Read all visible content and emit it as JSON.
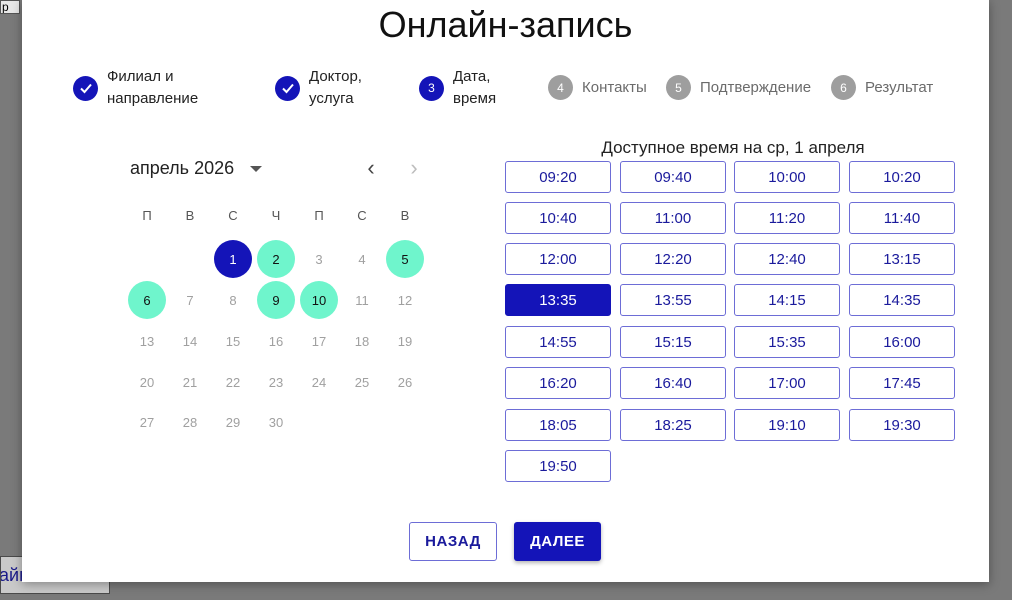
{
  "background": {
    "top_fragment": "р",
    "bottom_fragment": "айн"
  },
  "modal": {
    "title": "Онлайн-запись"
  },
  "steps": [
    {
      "status": "done",
      "icon": "check-icon",
      "label": "Филиал и\nнаправление"
    },
    {
      "status": "done",
      "icon": "check-icon",
      "label": "Доктор,\nуслуга"
    },
    {
      "status": "active",
      "number": "3",
      "label": "Дата,\nвремя"
    },
    {
      "status": "todo",
      "number": "4",
      "label": "Контакты"
    },
    {
      "status": "todo",
      "number": "5",
      "label": "Подтверждение"
    },
    {
      "status": "todo",
      "number": "6",
      "label": "Результат"
    }
  ],
  "calendar": {
    "month_label": "апрель 2026",
    "weekdays": [
      "П",
      "В",
      "С",
      "Ч",
      "П",
      "С",
      "В"
    ],
    "first_weekday_index": 2,
    "days_in_month": 30,
    "selected_day": 1,
    "available_days": [
      1,
      2,
      5,
      6,
      9,
      10
    ]
  },
  "slots": {
    "title": "Доступное время на ср, 1 апреля",
    "times": [
      "09:20",
      "09:40",
      "10:00",
      "10:20",
      "10:40",
      "11:00",
      "11:20",
      "11:40",
      "12:00",
      "12:20",
      "12:40",
      "13:15",
      "13:35",
      "13:55",
      "14:15",
      "14:35",
      "14:55",
      "15:15",
      "15:35",
      "16:00",
      "16:20",
      "16:40",
      "17:00",
      "17:45",
      "18:05",
      "18:25",
      "19:10",
      "19:30",
      "19:50"
    ],
    "selected": "13:35"
  },
  "buttons": {
    "back": "НАЗАД",
    "next": "ДАЛЕЕ"
  },
  "colors": {
    "primary": "#1414b8",
    "available_day": "#6ff5cc",
    "inactive_step": "#9e9e9e"
  }
}
